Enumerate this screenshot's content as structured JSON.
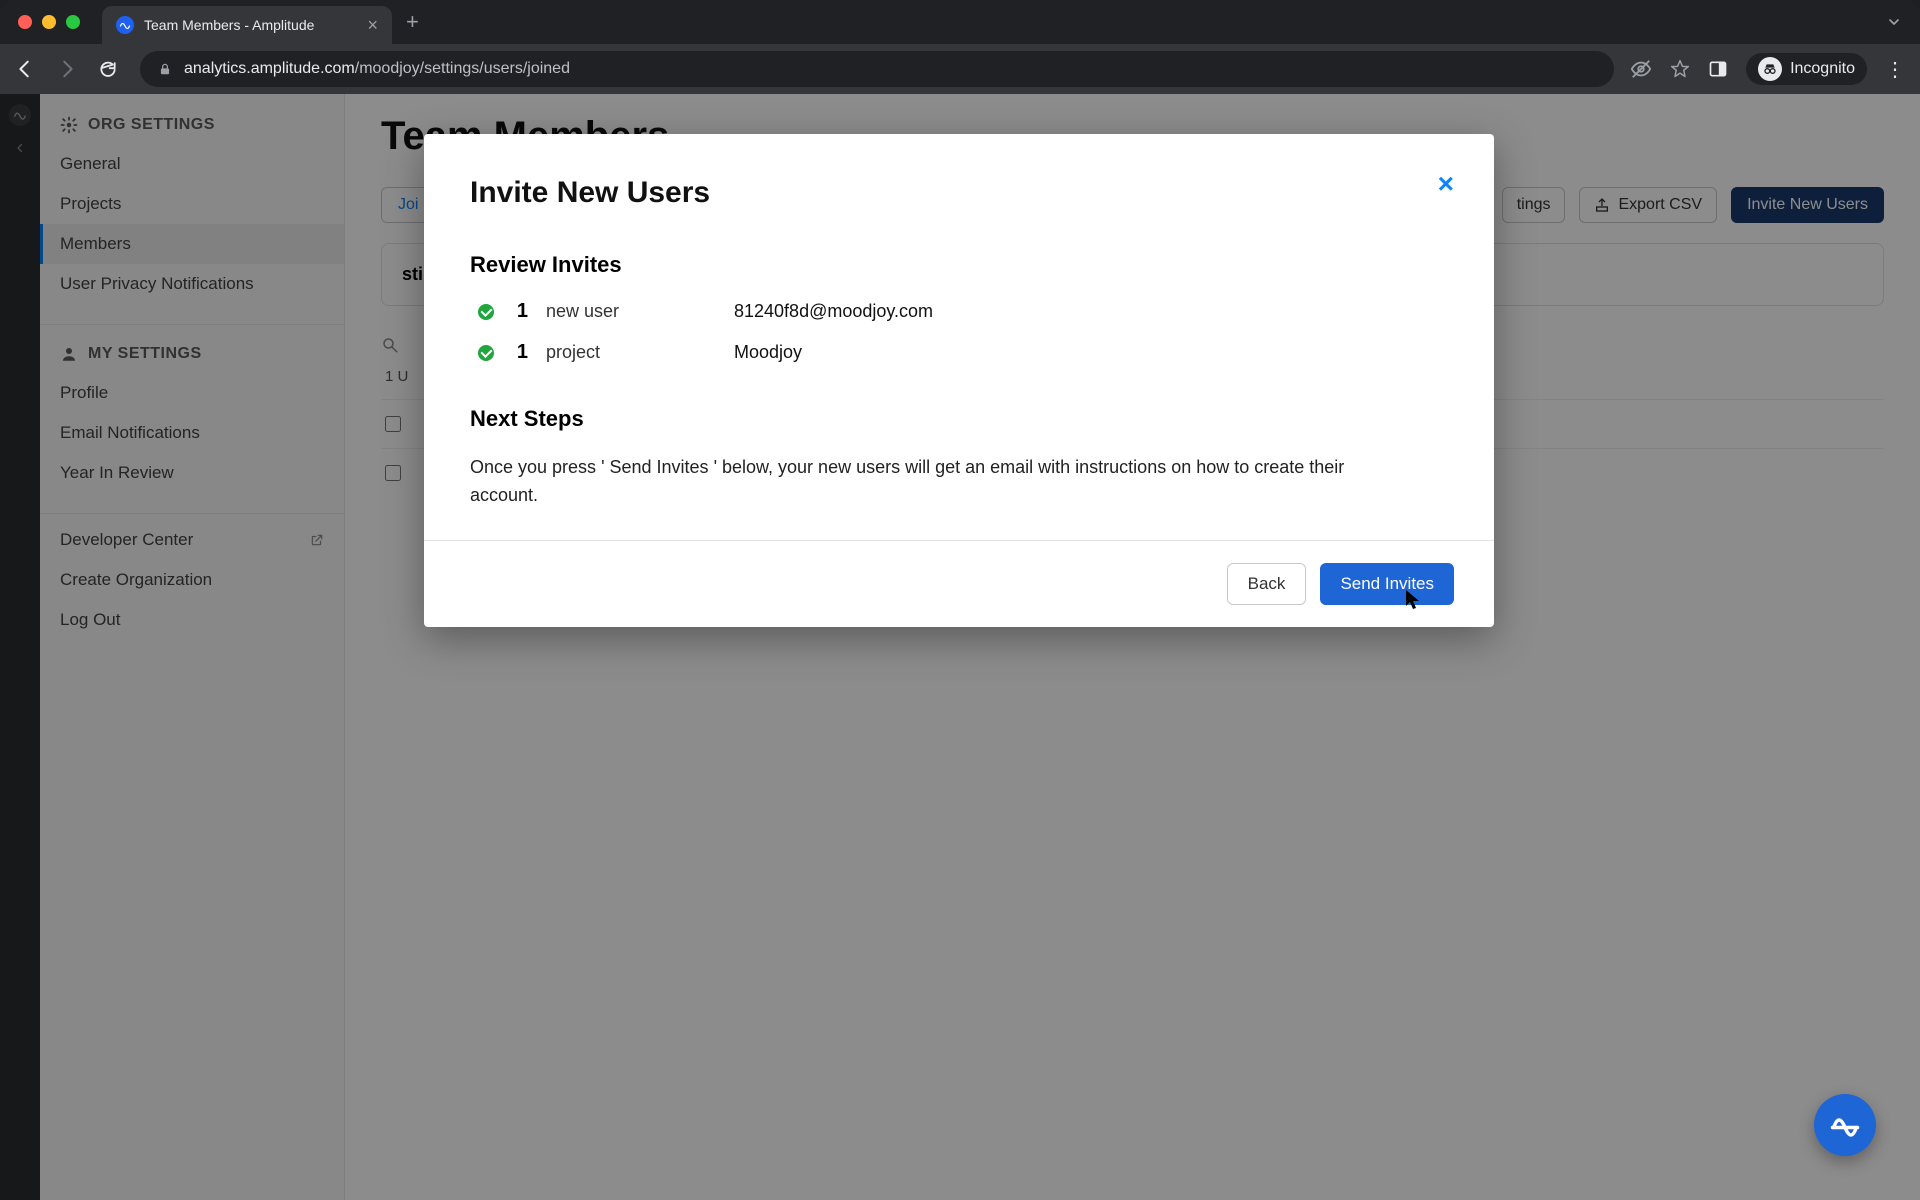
{
  "browser": {
    "tab_title": "Team Members - Amplitude",
    "url_host": "analytics.amplitude.com",
    "url_path": "/moodjoy/settings/users/joined",
    "incognito_label": "Incognito"
  },
  "sidebar": {
    "org_header": "ORG SETTINGS",
    "org_items": [
      "General",
      "Projects",
      "Members",
      "User Privacy Notifications"
    ],
    "org_active_index": 2,
    "my_header": "MY SETTINGS",
    "my_items": [
      "Profile",
      "Email Notifications",
      "Year In Review"
    ],
    "extra_items": [
      "Developer Center",
      "Create Organization",
      "Log Out"
    ]
  },
  "page": {
    "title": "Team Members",
    "tabs": [
      "Joi"
    ],
    "btn_settings_partial": "tings",
    "btn_export": "Export CSV",
    "btn_invite": "Invite New Users",
    "panel_header_partial": "sting Access",
    "count_row": "1 U"
  },
  "modal": {
    "title": "Invite New Users",
    "section_review": "Review Invites",
    "rows": [
      {
        "count": "1",
        "label": "new user",
        "value": "81240f8d@moodjoy.com"
      },
      {
        "count": "1",
        "label": "project",
        "value": "Moodjoy"
      }
    ],
    "section_next": "Next Steps",
    "next_text": "Once you press ' Send Invites ' below, your new users will get an email with instructions on how to create their account.",
    "btn_back": "Back",
    "btn_send": "Send Invites"
  }
}
